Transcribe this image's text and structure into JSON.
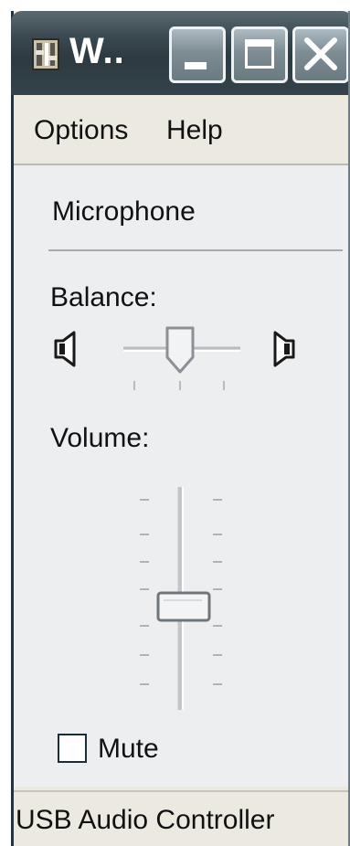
{
  "window": {
    "title": "W..",
    "icon": "app-icon",
    "caption_buttons": [
      "minimize-icon",
      "maximize-icon",
      "close-icon"
    ]
  },
  "menu": {
    "options_label": "Options",
    "help_label": "Help"
  },
  "panel": {
    "device_name": "Microphone",
    "balance_label": "Balance:",
    "balance_value": 0.5,
    "balance_left_icon": "speaker-left-icon",
    "balance_right_icon": "speaker-right-icon",
    "volume_label": "Volume:",
    "volume_value": 0.5,
    "mute_label": "Mute",
    "mute_checked": false
  },
  "status": {
    "text": "USB Audio Controller"
  },
  "colors": {
    "titlebar": "#3b4a51",
    "window_bg": "#eceae0",
    "panel_bg": "#eceef0"
  }
}
